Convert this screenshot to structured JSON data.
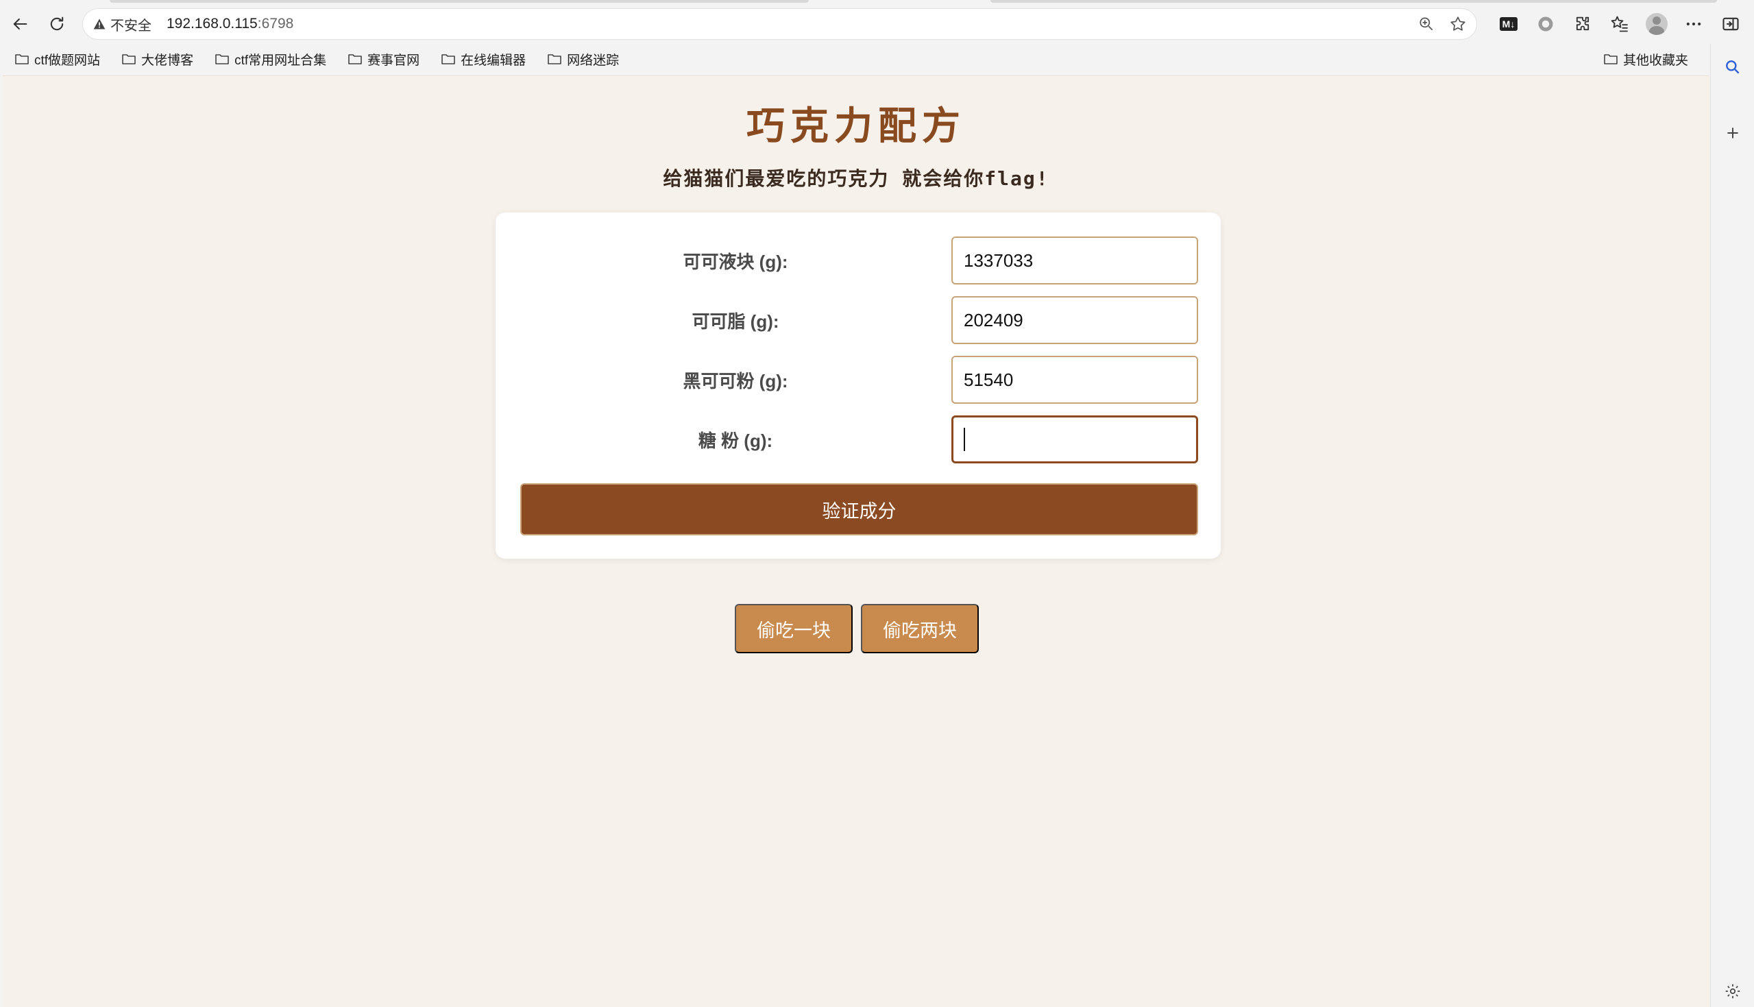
{
  "browser": {
    "security_label": "不安全",
    "url_host": "192.168.0.115",
    "url_port": ":6798",
    "bookmarks": [
      {
        "label": "ctf做题网站"
      },
      {
        "label": "大佬博客"
      },
      {
        "label": "ctf常用网址合集"
      },
      {
        "label": "赛事官网"
      },
      {
        "label": "在线编辑器"
      },
      {
        "label": "网络迷踪"
      }
    ],
    "other_bookmarks": "其他收藏夹",
    "markdown_badge": "M↓"
  },
  "page": {
    "title": "巧克力配方",
    "subtitle": "给猫猫们最爱吃的巧克力 就会给你flag!",
    "accent_color": "#8b4a22",
    "secondary_color": "#c98a4e",
    "background_color": "#f6f2eb",
    "form": {
      "fields": [
        {
          "label": "可可液块 (g):",
          "value": "1337033"
        },
        {
          "label": "可可脂 (g):",
          "value": "202409"
        },
        {
          "label": "黑可可粉 (g):",
          "value": "51540"
        },
        {
          "label": "糖 粉 (g):",
          "value": ""
        }
      ],
      "submit_label": "验证成分"
    },
    "actions": {
      "eat_one": "偷吃一块",
      "eat_two": "偷吃两块"
    }
  }
}
